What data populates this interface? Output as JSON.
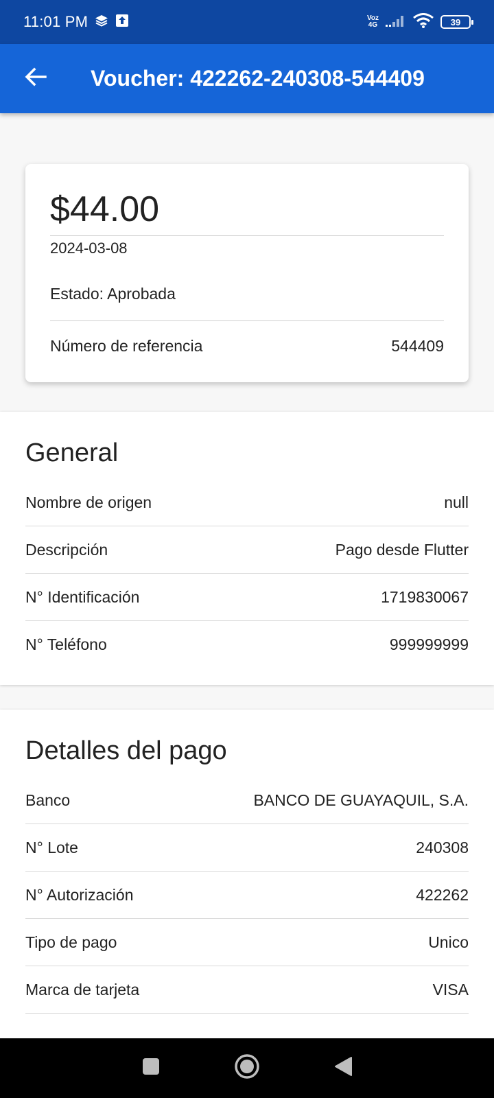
{
  "status_bar": {
    "time": "11:01 PM",
    "volte_top": "Voz",
    "volte_bottom": "4G",
    "battery": "39"
  },
  "app_bar": {
    "title": "Voucher: 422262-240308-544409"
  },
  "summary": {
    "amount": "$44.00",
    "date": "2024-03-08",
    "status": "Estado: Aprobada",
    "reference_label": "Número de referencia",
    "reference_value": "544409"
  },
  "general": {
    "title": "General",
    "rows": [
      {
        "label": "Nombre de origen",
        "value": "null"
      },
      {
        "label": "Descripción",
        "value": "Pago desde Flutter"
      },
      {
        "label": "N° Identificación",
        "value": "1719830067"
      },
      {
        "label": "N° Teléfono",
        "value": "999999999"
      }
    ]
  },
  "payment_details": {
    "title": "Detalles del pago",
    "rows": [
      {
        "label": "Banco",
        "value": "BANCO DE GUAYAQUIL, S.A."
      },
      {
        "label": "N° Lote",
        "value": "240308"
      },
      {
        "label": "N° Autorización",
        "value": "422262"
      },
      {
        "label": "Tipo de pago",
        "value": "Unico"
      },
      {
        "label": "Marca de tarjeta",
        "value": "VISA"
      }
    ]
  },
  "colors": {
    "status_bar": "#0e47a1",
    "app_bar": "#1565d8",
    "background": "#f7f7f7"
  },
  "icons": {
    "back": "arrow-left-icon",
    "recent": "square-icon",
    "home": "circle-icon",
    "nav_back": "triangle-back-icon"
  }
}
